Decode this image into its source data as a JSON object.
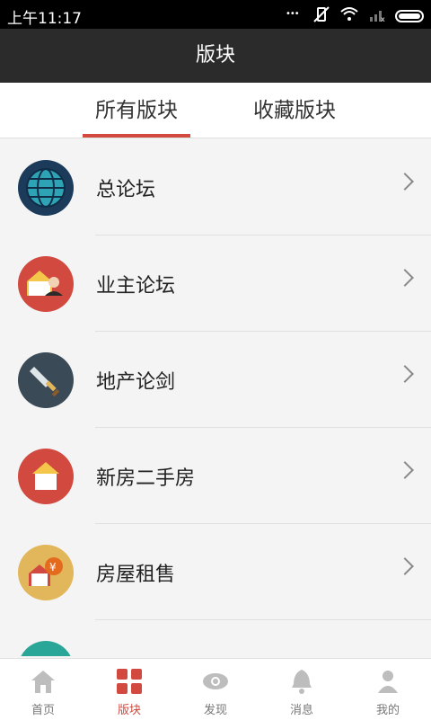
{
  "status": {
    "time": "上午11:17"
  },
  "header": {
    "title": "版块"
  },
  "tabs": [
    {
      "label": "所有版块"
    },
    {
      "label": "收藏版块"
    }
  ],
  "list": [
    {
      "label": "总论坛",
      "icon": "globe-icon",
      "color": "#1c3a5a"
    },
    {
      "label": "业主论坛",
      "icon": "owner-icon",
      "color": "#d24a3f"
    },
    {
      "label": "地产论剑",
      "icon": "sword-icon",
      "color": "#3b4a57"
    },
    {
      "label": "新房二手房",
      "icon": "house-icon",
      "color": "#d24a3f"
    },
    {
      "label": "房屋租售",
      "icon": "rent-icon",
      "color": "#e2b75b"
    }
  ],
  "nav": [
    {
      "label": "首页",
      "icon": "home-icon"
    },
    {
      "label": "版块",
      "icon": "grid-icon"
    },
    {
      "label": "发现",
      "icon": "eye-icon"
    },
    {
      "label": "消息",
      "icon": "bell-icon"
    },
    {
      "label": "我的",
      "icon": "user-icon"
    }
  ],
  "colors": {
    "accent": "#d24a3f",
    "titlebar": "#2b2b2b"
  }
}
